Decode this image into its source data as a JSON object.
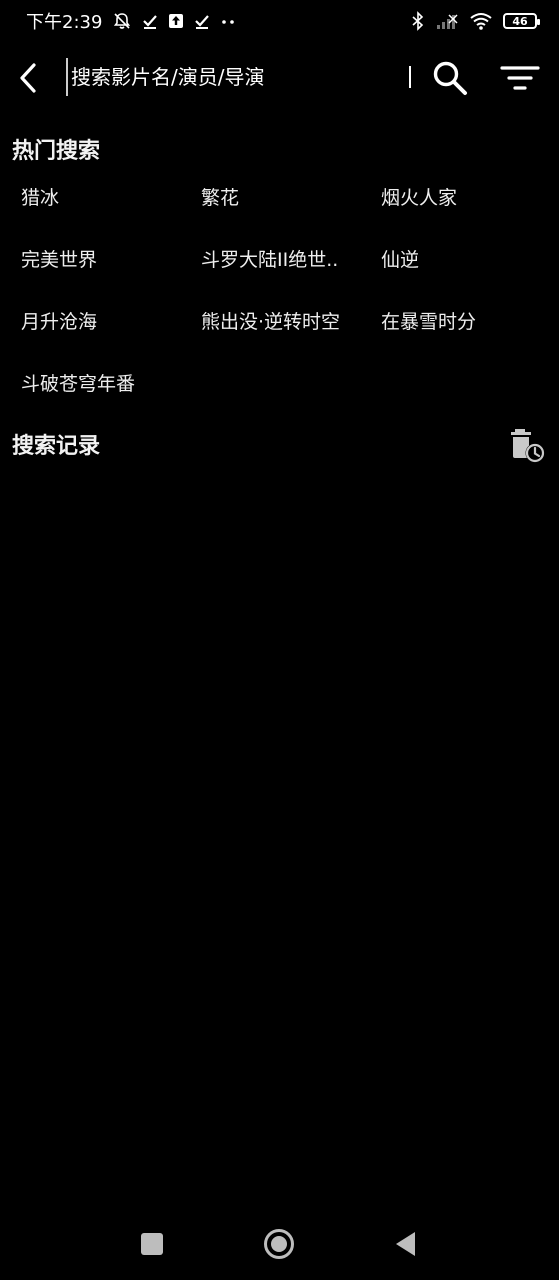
{
  "status_bar": {
    "time": "下午2:39",
    "battery": "46",
    "icons": [
      "mute-bell-icon",
      "check-icon",
      "upload-icon",
      "check-icon",
      "more-dots-icon",
      "bluetooth-icon",
      "signal-icon",
      "wifi-icon",
      "battery-icon"
    ]
  },
  "header": {
    "search_placeholder": "搜索影片名/演员/导演",
    "back_icon": "back-arrow-icon",
    "search_icon": "search-icon",
    "filter_icon": "filter-icon"
  },
  "hot_search": {
    "title": "热门搜索",
    "items": [
      "猎冰",
      "繁花",
      "烟火人家",
      "完美世界",
      "斗罗大陆II绝世..",
      "仙逆",
      "月升沧海",
      "熊出没·逆转时空",
      "在暴雪时分",
      "斗破苍穹年番"
    ]
  },
  "history": {
    "title": "搜索记录",
    "clear_icon": "delete-history-icon"
  },
  "nav": {
    "icons": [
      "recent-apps-icon",
      "home-icon",
      "back-triangle-icon"
    ]
  }
}
